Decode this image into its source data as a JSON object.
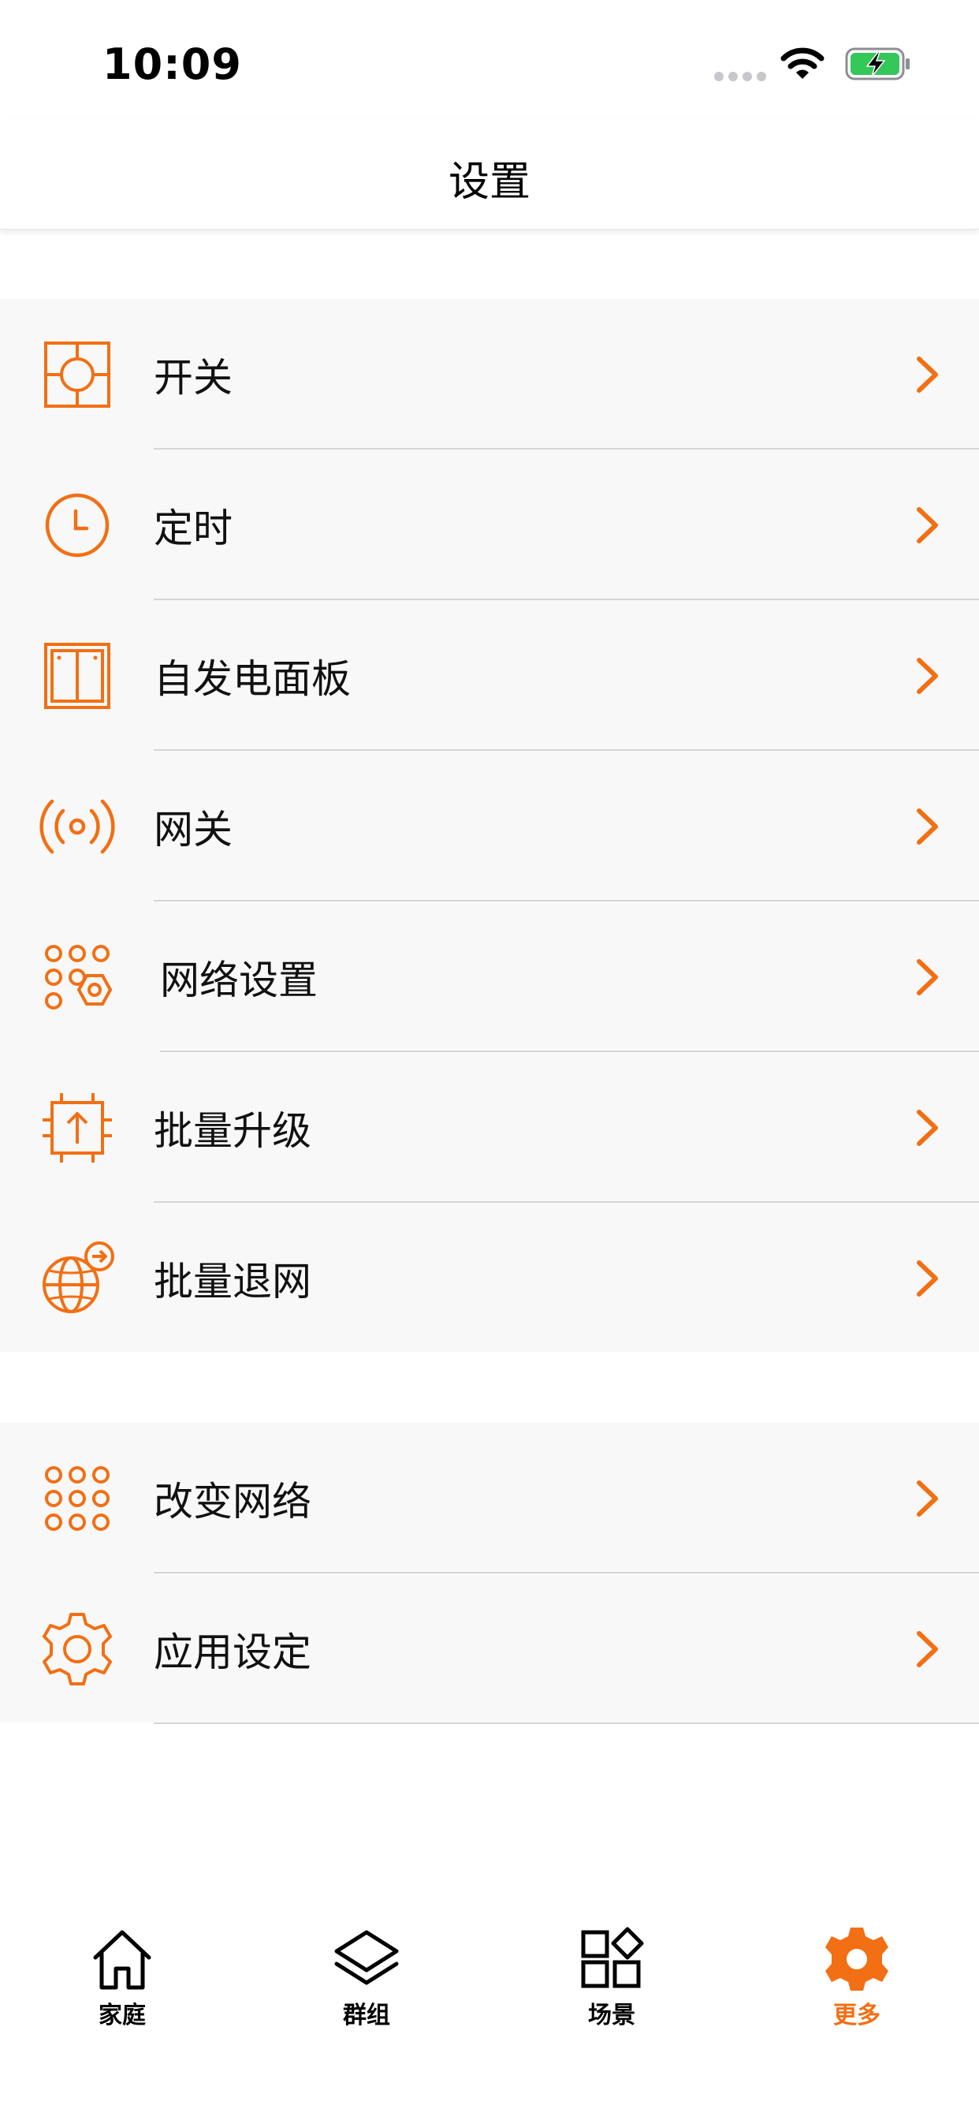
{
  "status_bar": {
    "time": "10:09"
  },
  "nav": {
    "title": "设置"
  },
  "accent_color": "#f26f13",
  "groups": [
    {
      "items": [
        {
          "label": "开关",
          "icon": "switch-icon"
        },
        {
          "label": "定时",
          "icon": "clock-icon"
        },
        {
          "label": "自发电面板",
          "icon": "panel-icon"
        },
        {
          "label": "网关",
          "icon": "gateway-icon"
        },
        {
          "label": "网络设置",
          "icon": "network-settings-icon"
        },
        {
          "label": "批量升级",
          "icon": "batch-upgrade-icon"
        },
        {
          "label": "批量退网",
          "icon": "batch-exit-network-icon"
        }
      ]
    },
    {
      "items": [
        {
          "label": "改变网络",
          "icon": "dot-grid-icon"
        },
        {
          "label": "应用设定",
          "icon": "gear-icon"
        }
      ]
    }
  ],
  "tabs": [
    {
      "label": "家庭",
      "icon": "home-icon",
      "active": false
    },
    {
      "label": "群组",
      "icon": "layers-icon",
      "active": false
    },
    {
      "label": "场景",
      "icon": "scene-grid-icon",
      "active": false
    },
    {
      "label": "更多",
      "icon": "gear-icon",
      "active": true
    }
  ]
}
